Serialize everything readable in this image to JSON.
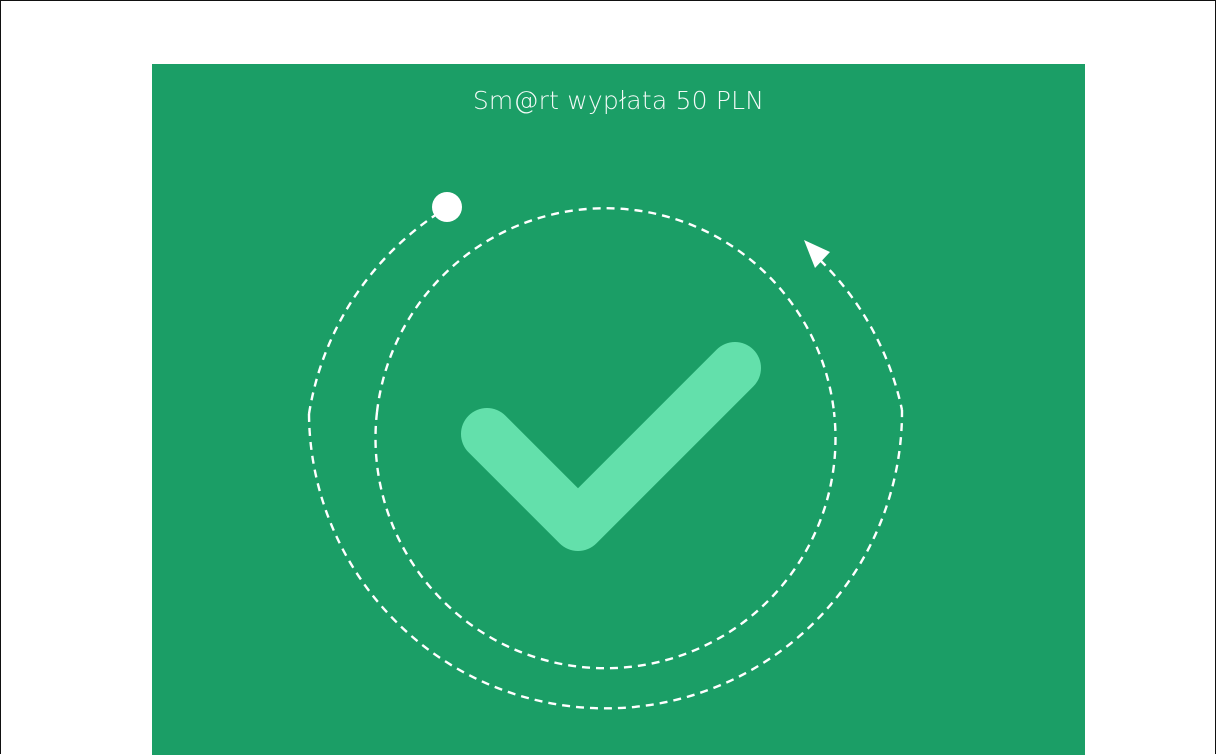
{
  "panel": {
    "title": "Sm@rt wypłata 50 PLN"
  },
  "colors": {
    "panel_background": "#1b9e66",
    "checkmark": "#63e0ab",
    "dashes": "#ffffff"
  },
  "icons": {
    "checkmark": "success-checkmark-icon",
    "dot": "orbit-dot-icon",
    "arrow": "orbit-arrow-icon"
  }
}
